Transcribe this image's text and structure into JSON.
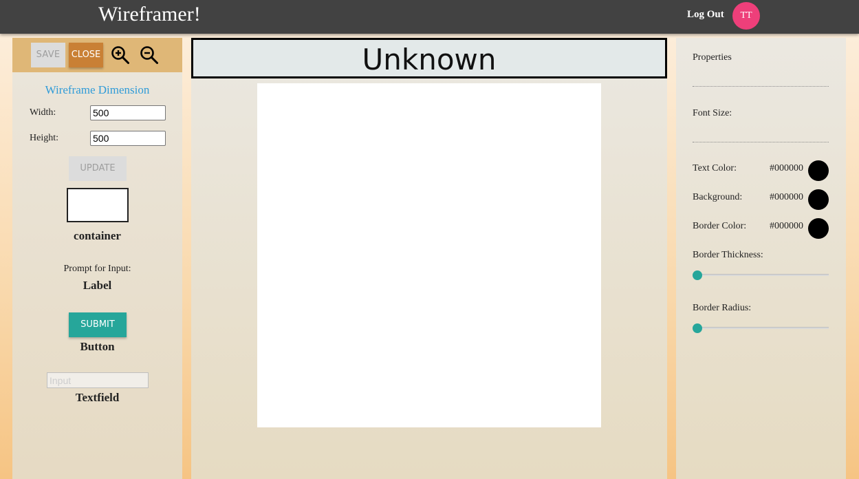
{
  "navbar": {
    "brand": "Wireframer!",
    "logout_label": "Log Out",
    "avatar_initials": "TT",
    "avatar_color": "#ee3f7a"
  },
  "toolbar": {
    "save_label": "SAVE",
    "close_label": "CLOSE",
    "zoom_in_icon": "zoom-in-icon",
    "zoom_out_icon": "zoom-out-icon"
  },
  "dimension": {
    "title": "Wireframe Dimension",
    "width_label": "Width:",
    "width_value": "500",
    "height_label": "Height:",
    "height_value": "500",
    "update_label": "UPDATE"
  },
  "components": {
    "container_caption": "container",
    "label_prompt": "Prompt for Input:",
    "label_caption": "Label",
    "button_text": "SUBMIT",
    "button_caption": "Button",
    "textfield_placeholder": "Input",
    "textfield_caption": "Textfield"
  },
  "wireframe": {
    "name": "Unknown"
  },
  "properties": {
    "title": "Properties",
    "font_size_label": "Font Size:",
    "text_color_label": "Text Color:",
    "text_color_value": "#000000",
    "background_label": "Background:",
    "background_value": "#000000",
    "border_color_label": "Border Color:",
    "border_color_value": "#000000",
    "border_thickness_label": "Border Thickness:",
    "border_thickness_value": 0,
    "border_radius_label": "Border Radius:",
    "border_radius_value": 0
  },
  "colors": {
    "navbar": "#424242",
    "accent_teal": "#26a69a",
    "close_button": "#c98035",
    "toolbar": "#dfb777",
    "title_blue": "#2f9bd8"
  }
}
